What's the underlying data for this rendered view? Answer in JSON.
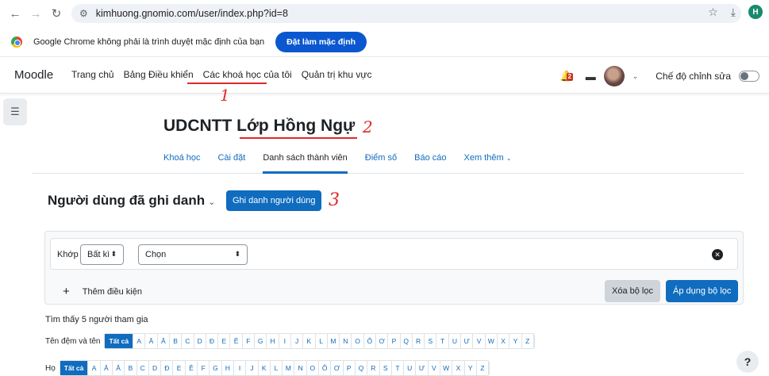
{
  "browser": {
    "url": "kimhuong.gnomio.com/user/index.php?id=8",
    "profile_initial": "H",
    "default_info": "Google Chrome không phải là trình duyệt mặc định của bạn",
    "default_button": "Đặt làm mặc định"
  },
  "navbar": {
    "brand": "Moodle",
    "links": [
      "Trang chủ",
      "Bảng Điều khiển",
      "Các khoá học của tôi",
      "Quản trị khu vực"
    ],
    "notification_count": "2",
    "edit_mode_label": "Chế độ chỉnh sửa"
  },
  "course": {
    "title": "UDCNTT Lớp Hồng Ngự"
  },
  "secondary_nav": [
    "Khoá học",
    "Cài đặt",
    "Danh sách thành viên",
    "Điểm số",
    "Báo cáo",
    "Xem thêm"
  ],
  "page": {
    "heading": "Người dùng đã ghi danh",
    "enrol_button": "Ghi danh người dùng"
  },
  "annotations": [
    "1",
    "2",
    "3"
  ],
  "filter": {
    "match_label": "Khớp",
    "match_value": "Bất kì",
    "condition_value": "Chọn",
    "add_condition": "Thêm điều kiện",
    "clear_button": "Xóa bộ lọc",
    "apply_button": "Áp dụng bộ lọc"
  },
  "results_text": "Tìm thấy 5 người tham gia",
  "initials": {
    "firstname_label": "Tên đệm và tên",
    "lastname_label": "Họ",
    "all_label": "Tất cả",
    "letters": [
      "A",
      "Ă",
      "Â",
      "B",
      "C",
      "D",
      "Đ",
      "E",
      "Ê",
      "F",
      "G",
      "H",
      "I",
      "J",
      "K",
      "L",
      "M",
      "N",
      "O",
      "Ô",
      "Ơ",
      "P",
      "Q",
      "R",
      "S",
      "T",
      "U",
      "Ư",
      "V",
      "W",
      "X",
      "Y",
      "Z"
    ]
  },
  "colors": {
    "primary": "#0f6cbf",
    "annotation_red": "#e02828"
  }
}
